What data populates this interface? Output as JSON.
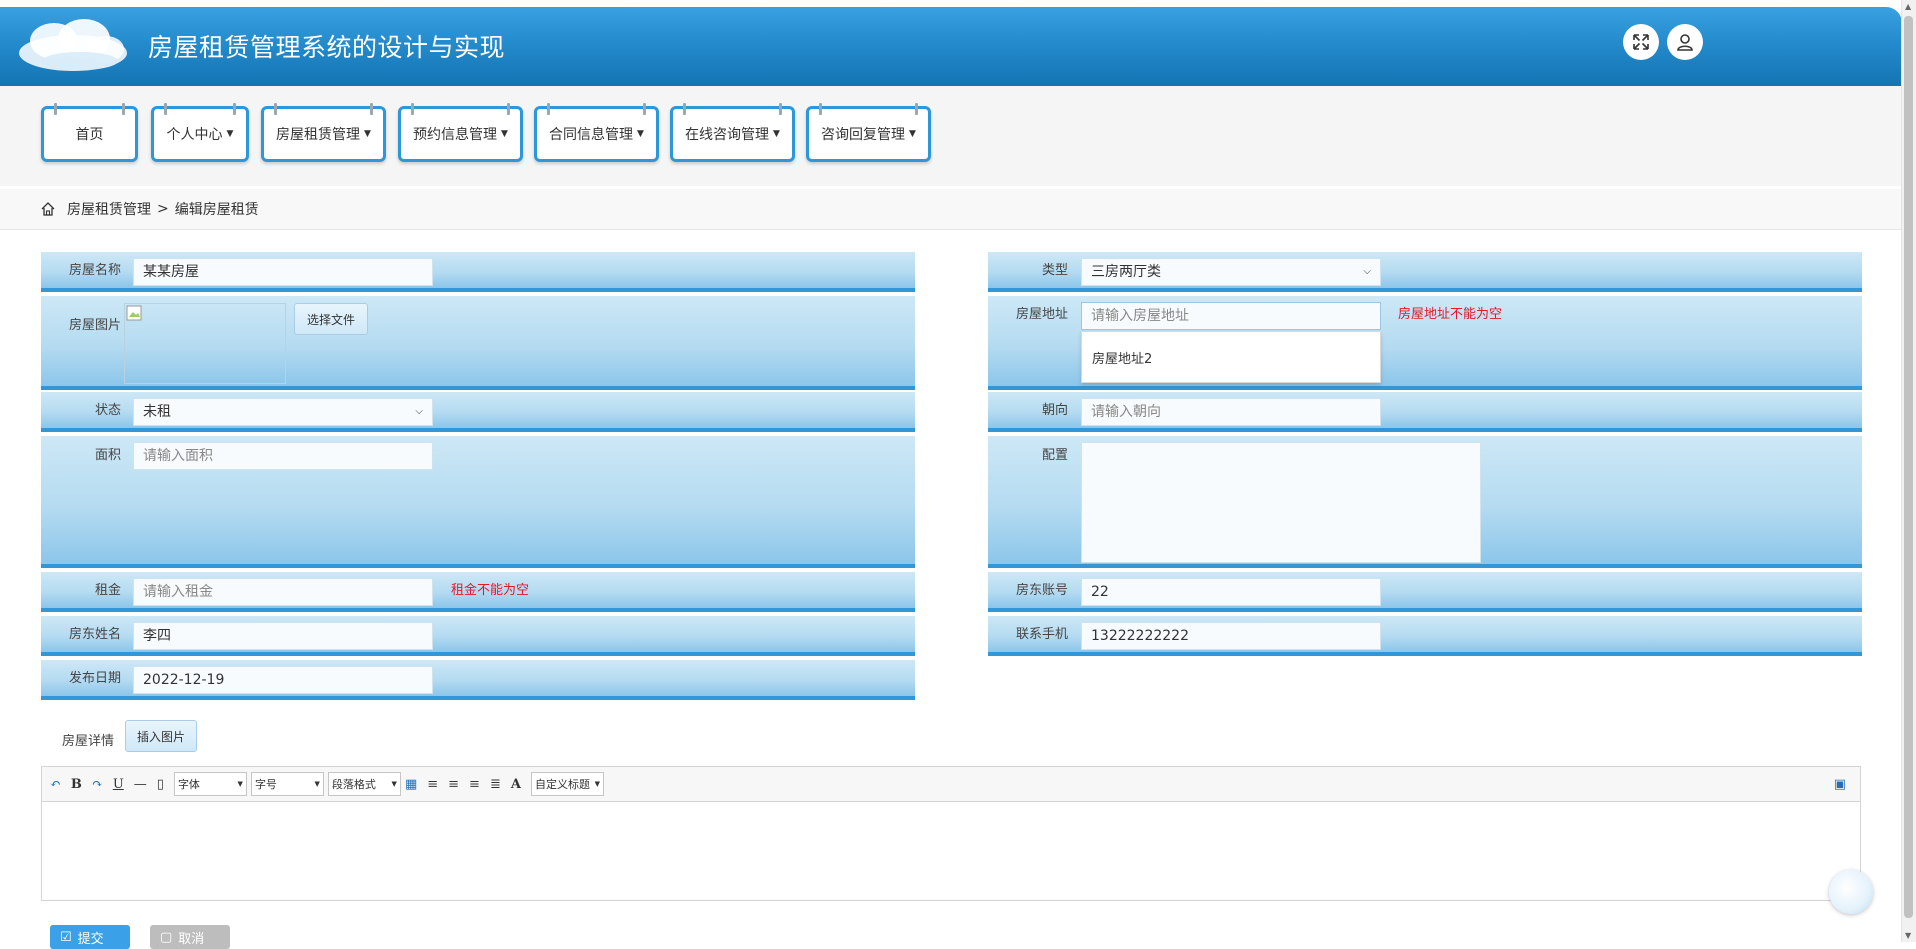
{
  "app": {
    "title": "房屋租赁管理系统的设计与实现"
  },
  "nav": [
    {
      "label": "首页"
    },
    {
      "label": "个人中心"
    },
    {
      "label": "房屋租赁管理"
    },
    {
      "label": "预约信息管理"
    },
    {
      "label": "合同信息管理"
    },
    {
      "label": "在线咨询管理"
    },
    {
      "label": "咨询回复管理"
    }
  ],
  "breadcrumb": {
    "parent": "房屋租赁管理",
    "separator": ">",
    "current": "编辑房屋租赁"
  },
  "form": {
    "house_name": {
      "label": "房屋名称",
      "value": "某某房屋"
    },
    "house_image": {
      "label": "房屋图片",
      "button": "选择文件"
    },
    "status": {
      "label": "状态",
      "value": "未租"
    },
    "area": {
      "label": "面积",
      "placeholder": "请输入面积"
    },
    "rent": {
      "label": "租金",
      "placeholder": "请输入租金",
      "error": "租金不能为空"
    },
    "landlord_name": {
      "label": "房东姓名",
      "value": "李四"
    },
    "publish_date": {
      "label": "发布日期",
      "value": "2022-12-19"
    },
    "type": {
      "label": "类型",
      "value": "三房两厅类"
    },
    "address": {
      "label": "房屋地址",
      "placeholder": "请输入房屋地址",
      "error": "房屋地址不能为空",
      "suggestion": "房屋地址2"
    },
    "orientation": {
      "label": "朝向",
      "placeholder": "请输入朝向"
    },
    "config": {
      "label": "配置"
    },
    "landlord_account": {
      "label": "房东账号",
      "value": "22"
    },
    "phone": {
      "label": "联系手机",
      "value": "13222222222"
    },
    "details": {
      "label": "房屋详情",
      "insert_image": "插入图片"
    }
  },
  "editor": {
    "font_select": "字体",
    "size_select": "字号",
    "paragraph_select": "段落格式",
    "custom_title_select": "自定义标题",
    "bold": "B",
    "underline": "U",
    "font_color": "A"
  },
  "footer": {
    "submit": "提交",
    "cancel": "取消"
  },
  "colors": {
    "header": "#248bcc",
    "nav_border": "#2d97db",
    "row_bottom": "#3397d6",
    "error": "#e4172b"
  }
}
